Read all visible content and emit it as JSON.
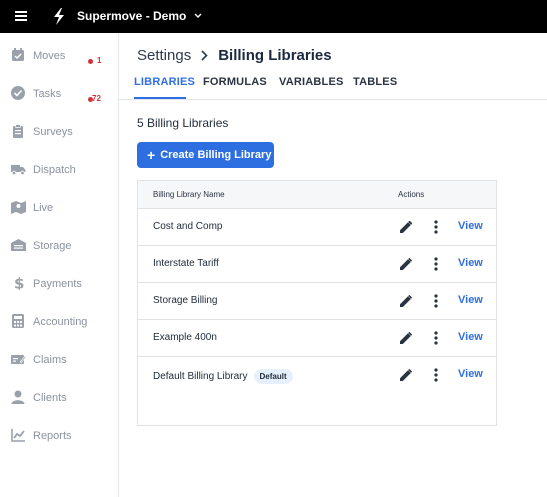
{
  "topbar": {
    "org_name": "Supermove - Demo"
  },
  "sidebar": {
    "items": [
      {
        "label": "Moves",
        "icon": "calendar-check-icon",
        "badge": "1"
      },
      {
        "label": "Tasks",
        "icon": "check-circle-icon",
        "badge": "72"
      },
      {
        "label": "Surveys",
        "icon": "clipboard-icon"
      },
      {
        "label": "Dispatch",
        "icon": "truck-icon"
      },
      {
        "label": "Live",
        "icon": "map-icon"
      },
      {
        "label": "Storage",
        "icon": "warehouse-icon"
      },
      {
        "label": "Payments",
        "icon": "dollar-icon"
      },
      {
        "label": "Accounting",
        "icon": "calculator-icon"
      },
      {
        "label": "Claims",
        "icon": "claims-icon"
      },
      {
        "label": "Clients",
        "icon": "user-icon"
      },
      {
        "label": "Reports",
        "icon": "chart-line-icon"
      }
    ]
  },
  "breadcrumb": {
    "root": "Settings",
    "current": "Billing Libraries"
  },
  "tabs": [
    "LIBRARIES",
    "FORMULAS",
    "VARIABLES",
    "TABLES"
  ],
  "active_tab": "LIBRARIES",
  "content": {
    "count_title": "5 Billing Libraries",
    "create_button": "Create Billing Library"
  },
  "table": {
    "headers": {
      "name": "Billing Library Name",
      "actions": "Actions"
    },
    "rows": [
      {
        "name": "Cost and Comp",
        "view": "View"
      },
      {
        "name": "Interstate Tariff",
        "view": "View"
      },
      {
        "name": "Storage Billing",
        "view": "View"
      },
      {
        "name": "Example 400n",
        "view": "View"
      },
      {
        "name": "Default Billing Library",
        "tag": "Default",
        "view": "View"
      }
    ]
  },
  "colors": {
    "accent": "#2d6fe0",
    "badge": "#d0323a",
    "topbar": "#000000"
  }
}
